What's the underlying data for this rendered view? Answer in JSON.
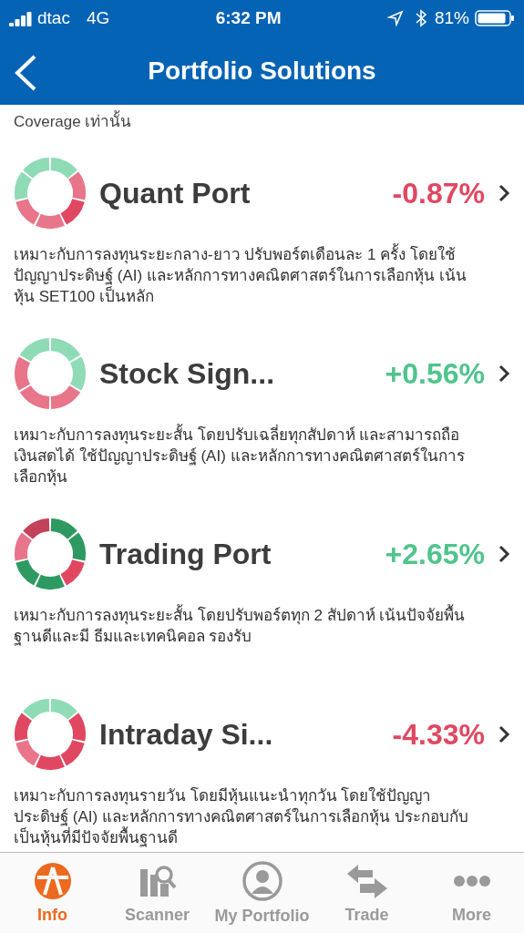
{
  "status_bar": {
    "carrier": "dtac",
    "network": "4G",
    "time": "6:32 PM",
    "battery": "81%"
  },
  "nav": {
    "title": "Portfolio Solutions"
  },
  "intro_text": "Coverage เท่านั้น",
  "portfolios": [
    {
      "name": "Quant Port",
      "change": "-0.87%",
      "color": "#e04862",
      "segments": [
        {
          "color": "#8edbb6"
        },
        {
          "color": "#e8758a"
        },
        {
          "color": "#e04862"
        },
        {
          "color": "#e8758a"
        },
        {
          "color": "#e8758a"
        },
        {
          "color": "#8edbb6"
        },
        {
          "color": "#8edbb6"
        }
      ],
      "description": "เหมาะกับการลงทุนระยะกลาง-ยาว ปรับพอร์ตเดือนละ 1 ครั้ง โดยใช้ปัญญาประดิษฐ์ (AI) และหลักการทางคณิตศาสตร์ในการเลือกหุ้น เน้นหุ้น SET100 เป็นหลัก"
    },
    {
      "name": "Stock Sign...",
      "change": "+0.56%",
      "color": "#50c48c",
      "segments": [
        {
          "color": "#8edbb6"
        },
        {
          "color": "#8edbb6"
        },
        {
          "color": "#e8758a"
        },
        {
          "color": "#e8758a"
        },
        {
          "color": "#e8758a"
        },
        {
          "color": "#8edbb6"
        }
      ],
      "description": "เหมาะกับการลงทุนระยะสั้น โดยปรับเฉลี่ยทุกสัปดาห์ และสามารถถือเงินสดได้ ใช้ปัญญาประดิษฐ์ (AI) และหลักการทางคณิตศาสตร์ในการเลือกหุ้น"
    },
    {
      "name": "Trading Port",
      "change": "+2.65%",
      "color": "#50c48c",
      "segments": [
        {
          "color": "#2e9a62"
        },
        {
          "color": "#2e9a62"
        },
        {
          "color": "#e04862"
        },
        {
          "color": "#2e9a62"
        },
        {
          "color": "#2e9a62"
        },
        {
          "color": "#e8758a"
        },
        {
          "color": "#c4415a"
        }
      ],
      "description": "เหมาะกับการลงทุนระยะสั้น โดยปรับพอร์ตทุก 2 สัปดาห์ เน้นปัจจัยพื้นฐานดีและมี ธีมและเทคนิคอล รองรับ"
    },
    {
      "name": "Intraday Si...",
      "change": "-4.33%",
      "color": "#e04862",
      "segments": [
        {
          "color": "#8edbb6"
        },
        {
          "color": "#e04862"
        },
        {
          "color": "#e04862"
        },
        {
          "color": "#e04862"
        },
        {
          "color": "#e8758a"
        },
        {
          "color": "#e04862"
        },
        {
          "color": "#8edbb6"
        }
      ],
      "description": "เหมาะกับการลงทุนรายวัน โดยมีหุ้นแนะนำทุกวัน โดยใช้ปัญญาประดิษฐ์ (AI) และหลักการทางคณิตศาสตร์ในการเลือกหุ้น ประกอบกับเป็นหุ้นที่มีปัจจัยพื้นฐานดี"
    }
  ],
  "tabs": [
    {
      "label": "Info",
      "kind": "info",
      "selected": true
    },
    {
      "label": "Scanner",
      "kind": "scanner",
      "selected": false
    },
    {
      "label": "My Portfolio",
      "kind": "portfolio",
      "selected": false
    },
    {
      "label": "Trade",
      "kind": "trade",
      "selected": false
    },
    {
      "label": "More",
      "kind": "more",
      "selected": false
    }
  ]
}
